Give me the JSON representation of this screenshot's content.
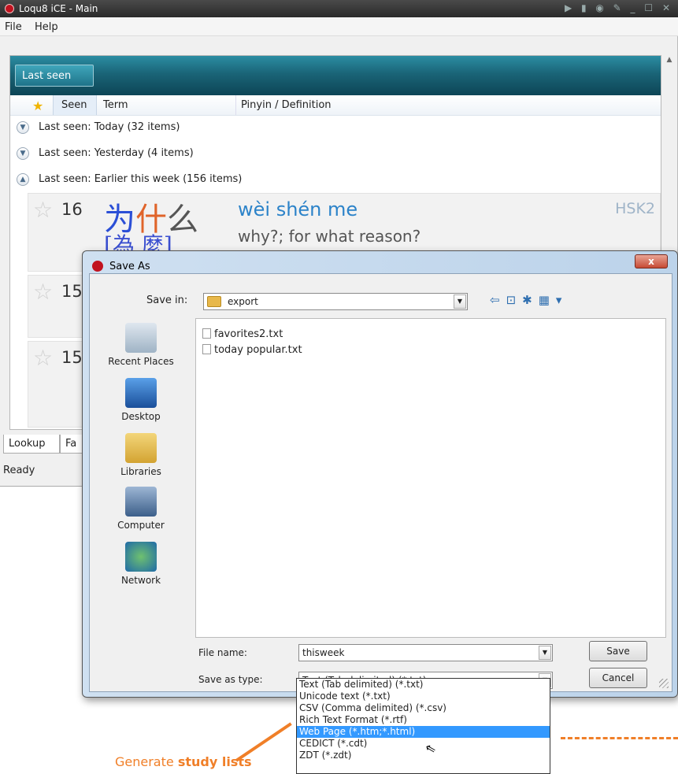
{
  "app": {
    "title": "Loqu8 iCE - Main",
    "menu": [
      "File",
      "Help"
    ],
    "toolband_tab": "Last seen",
    "columns": {
      "seen": "Seen",
      "term": "Term",
      "pinyin": "Pinyin / Definition"
    },
    "groups": [
      {
        "label": "Last seen: Today (32 items)",
        "expanded": false
      },
      {
        "label": "Last seen: Yesterday (4 items)",
        "expanded": false
      },
      {
        "label": "Last seen: Earlier this week (156 items)",
        "expanded": true
      }
    ],
    "entries": [
      {
        "count": "16",
        "hanzi": [
          "为",
          "什",
          "么"
        ],
        "trad": "[為 麼]",
        "pinyin": "wèi shén me",
        "definition": "why?; for what reason?",
        "badge": "HSK2"
      },
      {
        "count": "15"
      },
      {
        "count": "15"
      }
    ],
    "bottom_tabs": [
      "Lookup",
      "Fa"
    ],
    "status": "Ready"
  },
  "dialog": {
    "title": "Save As",
    "close": "x",
    "save_in_label": "Save in:",
    "save_in_value": "export",
    "places": [
      "Recent Places",
      "Desktop",
      "Libraries",
      "Computer",
      "Network"
    ],
    "files": [
      "favorites2.txt",
      "today popular.txt"
    ],
    "file_name_label": "File name:",
    "file_name_value": "thisweek",
    "save_as_type_label": "Save as type:",
    "save_as_type_value": "Text (Tab delimited) (*.txt)",
    "save_button": "Save",
    "cancel_button": "Cancel",
    "type_options": [
      "Text (Tab delimited) (*.txt)",
      "Unicode text (*.txt)",
      "CSV (Comma delimited) (*.csv)",
      "Rich Text Format (*.rtf)",
      "Web Page (*.htm;*.html)",
      "CEDICT (*.cdt)",
      "ZDT (*.zdt)"
    ],
    "highlighted_option_index": 4
  },
  "callout": {
    "prefix": "Generate ",
    "bold": "study lists"
  },
  "colors": {
    "accent_orange": "#f07f28",
    "selection_blue": "#3399ff",
    "toolband_teal": "#1a6477"
  }
}
